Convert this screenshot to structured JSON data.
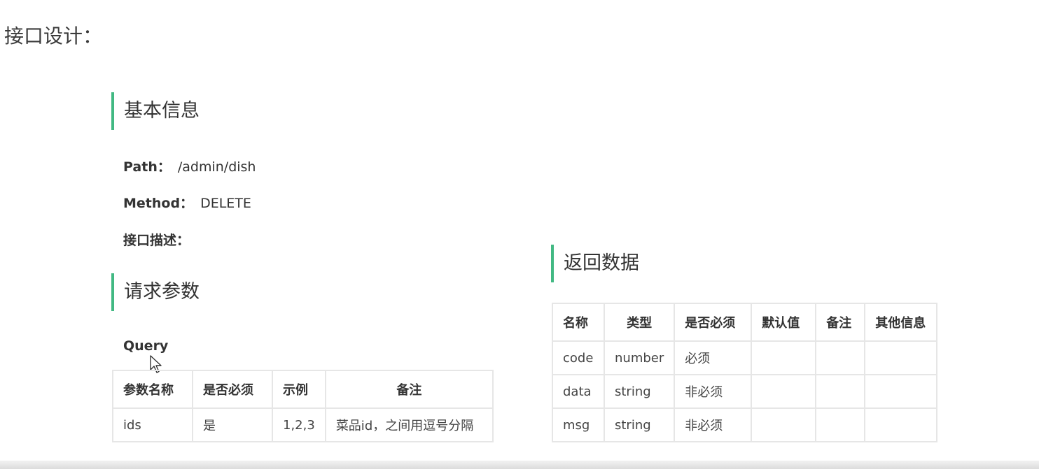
{
  "page": {
    "heading": "接口设计："
  },
  "basic_info": {
    "title": "基本信息",
    "path_label": "Path：",
    "path_value": "/admin/dish",
    "method_label": "Method：",
    "method_value": "DELETE",
    "desc_label": "接口描述："
  },
  "request": {
    "title": "请求参数",
    "query_label": "Query",
    "headers": [
      "参数名称",
      "是否必须",
      "示例",
      "备注"
    ],
    "rows": [
      [
        "ids",
        "是",
        "1,2,3",
        "菜品id，之间用逗号分隔"
      ]
    ]
  },
  "response": {
    "title": "返回数据",
    "headers": [
      "名称",
      "类型",
      "是否必须",
      "默认值",
      "备注",
      "其他信息"
    ],
    "rows": [
      [
        "code",
        "number",
        "必须",
        "",
        "",
        ""
      ],
      [
        "data",
        "string",
        "非必须",
        "",
        "",
        ""
      ],
      [
        "msg",
        "string",
        "非必须",
        "",
        "",
        ""
      ]
    ]
  },
  "colors": {
    "accent": "#42b983",
    "border": "#e6e6e6",
    "text": "#333333"
  },
  "icons": {
    "cursor": "mouse-pointer-icon"
  }
}
